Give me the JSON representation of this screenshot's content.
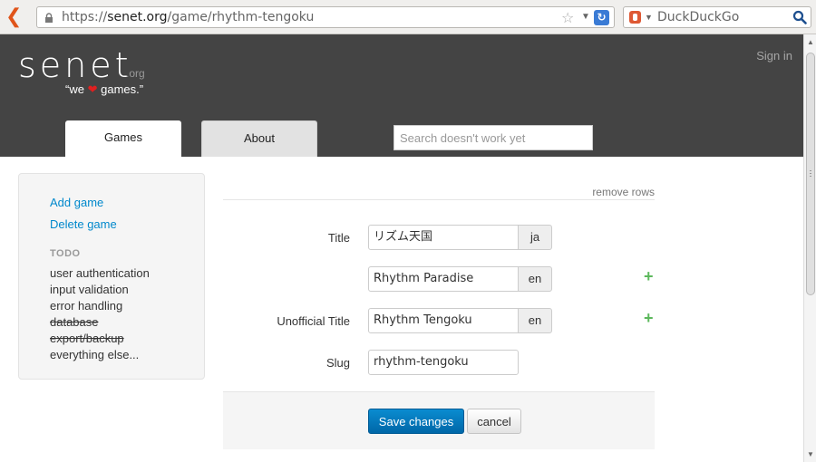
{
  "browser": {
    "url_prefix": "https://",
    "url_domain": "senet.org",
    "url_path": "/game/rhythm-tengoku",
    "search_engine": "DuckDuckGo",
    "icons": [
      "back-arrow-icon",
      "lock-icon",
      "star-icon",
      "dropdown-icon",
      "reload-icon",
      "duckduckgo-icon",
      "magnifier-icon"
    ]
  },
  "header": {
    "logo": "senet",
    "logo_tld": ".org",
    "tagline_before": "“we",
    "tagline_heart": "❤",
    "tagline_after": "games.”",
    "sign_in": "Sign in",
    "tabs": [
      {
        "label": "Games",
        "active": true
      },
      {
        "label": "About",
        "active": false
      }
    ],
    "search_placeholder": "Search doesn't work yet"
  },
  "sidebar": {
    "links": [
      {
        "label": "Add game"
      },
      {
        "label": "Delete game"
      }
    ],
    "todo_heading": "TODO",
    "todo": [
      {
        "label": "user authentication",
        "done": false
      },
      {
        "label": "input validation",
        "done": false
      },
      {
        "label": "error handling",
        "done": false
      },
      {
        "label": "database",
        "done": true
      },
      {
        "label": "export/backup",
        "done": true
      },
      {
        "label": "everything else...",
        "done": false
      }
    ]
  },
  "form": {
    "remove_rows": "remove rows",
    "title_label": "Title",
    "titles": [
      {
        "value": "リズム天国",
        "lang": "ja"
      },
      {
        "value": "Rhythm Paradise",
        "lang": "en"
      }
    ],
    "unofficial_label": "Unofficial Title",
    "unofficial": {
      "value": "Rhythm Tengoku",
      "lang": "en"
    },
    "slug_label": "Slug",
    "slug": "rhythm-tengoku",
    "plus": "+",
    "save_label": "Save changes",
    "cancel_label": "cancel"
  },
  "colors": {
    "header_bg": "#444444",
    "link": "#0088cc",
    "primary_button": "#0077bb",
    "plus": "#5cb85c",
    "heart": "#e02020"
  }
}
